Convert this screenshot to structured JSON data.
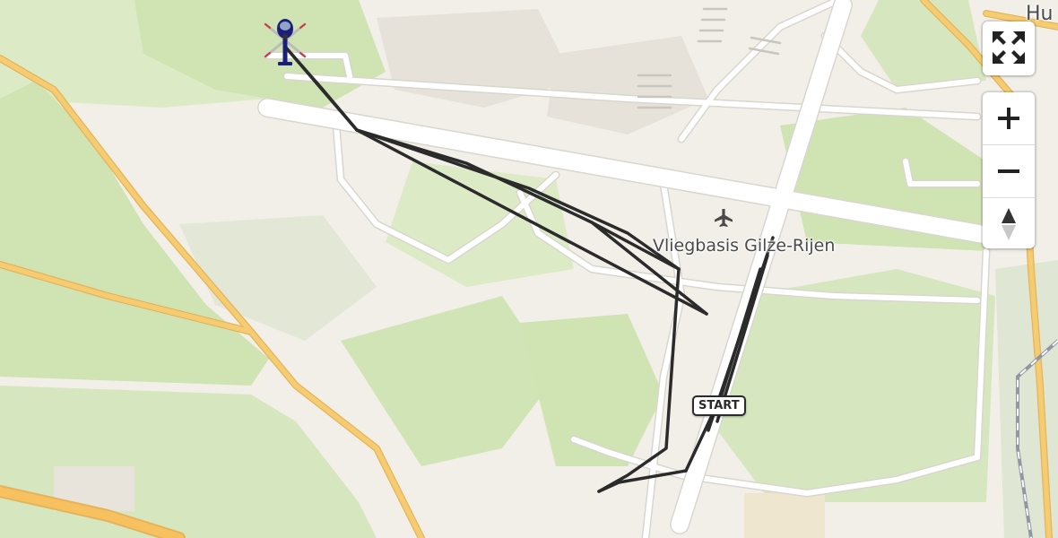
{
  "map": {
    "labels": {
      "airbase": "Vliegbasis Gilze-Rijen",
      "town_partial": "Hu"
    },
    "start_marker": {
      "label": "START"
    },
    "aircraft_marker": {
      "icon": "helicopter-icon"
    },
    "airport_icon": "airplane-icon",
    "colors": {
      "background": "#f2efe9",
      "forest": "#cfe3b3",
      "grass": "#dcebc6",
      "major_road": "#f6cc72",
      "minor_road": "#ffffff",
      "runway": "#ffffff",
      "track": "#2b2b2b",
      "railway": "#9097a3",
      "helicopter_body": "#1b1f7a"
    }
  },
  "controls": {
    "fullscreen": {
      "icon": "fullscreen-icon"
    },
    "zoom_in": {
      "icon": "plus-icon"
    },
    "zoom_out": {
      "icon": "minus-icon"
    },
    "compass": {
      "icon": "compass-icon"
    }
  }
}
